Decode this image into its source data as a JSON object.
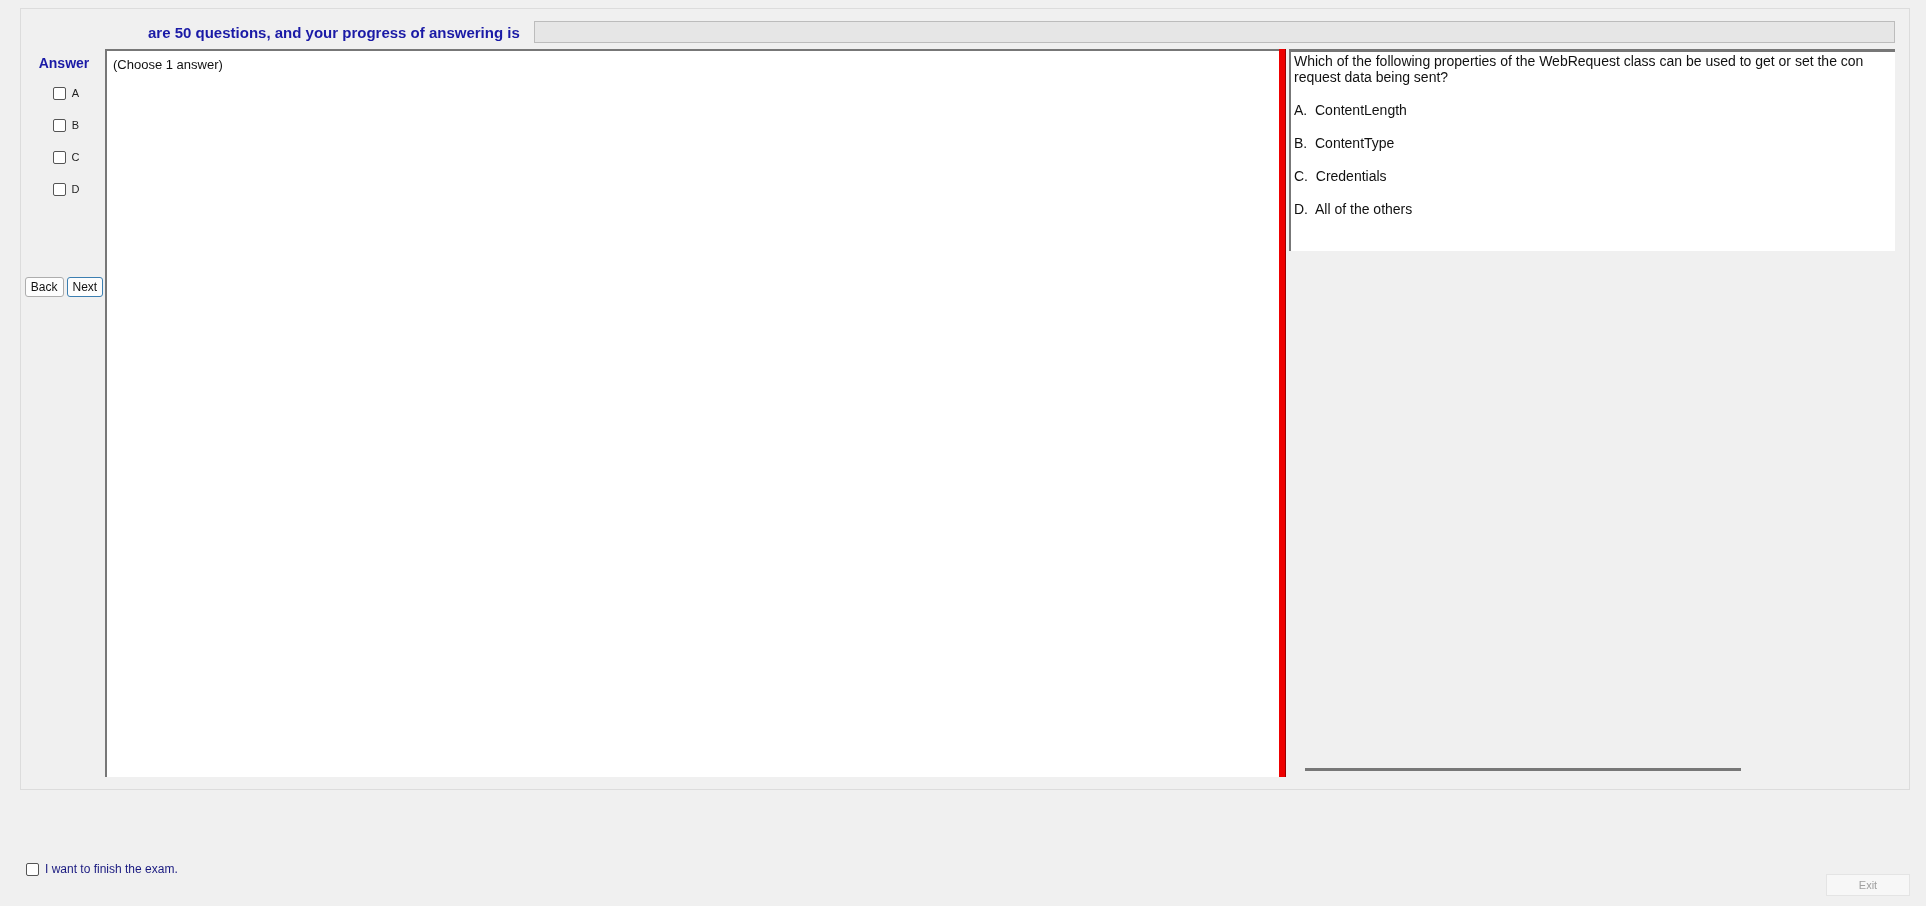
{
  "header": {
    "text": "are 50 questions, and your progress of answering is",
    "progress": {
      "level": 0
    }
  },
  "answer_panel": {
    "title": "Answer",
    "options": [
      {
        "label": "A",
        "checked": false
      },
      {
        "label": "B",
        "checked": false
      },
      {
        "label": "C",
        "checked": false
      },
      {
        "label": "D",
        "checked": false
      }
    ],
    "buttons": [
      {
        "label": "Back",
        "selected": false
      },
      {
        "label": "Next",
        "selected": true
      }
    ]
  },
  "answer_pane": {
    "hint": "(Choose 1 answer)"
  },
  "question": {
    "text": "Which of the following properties of the WebRequest class can be used to get or set the con",
    "continuation": "request data being sent?",
    "choices": [
      "A.  ContentLength",
      "B.  ContentType",
      "C.  Credentials",
      "D.  All of the others"
    ]
  },
  "finish": {
    "label": "I want to finish the exam.",
    "checked": false
  },
  "exit_button": {
    "label": "Exit",
    "disabled": true
  }
}
